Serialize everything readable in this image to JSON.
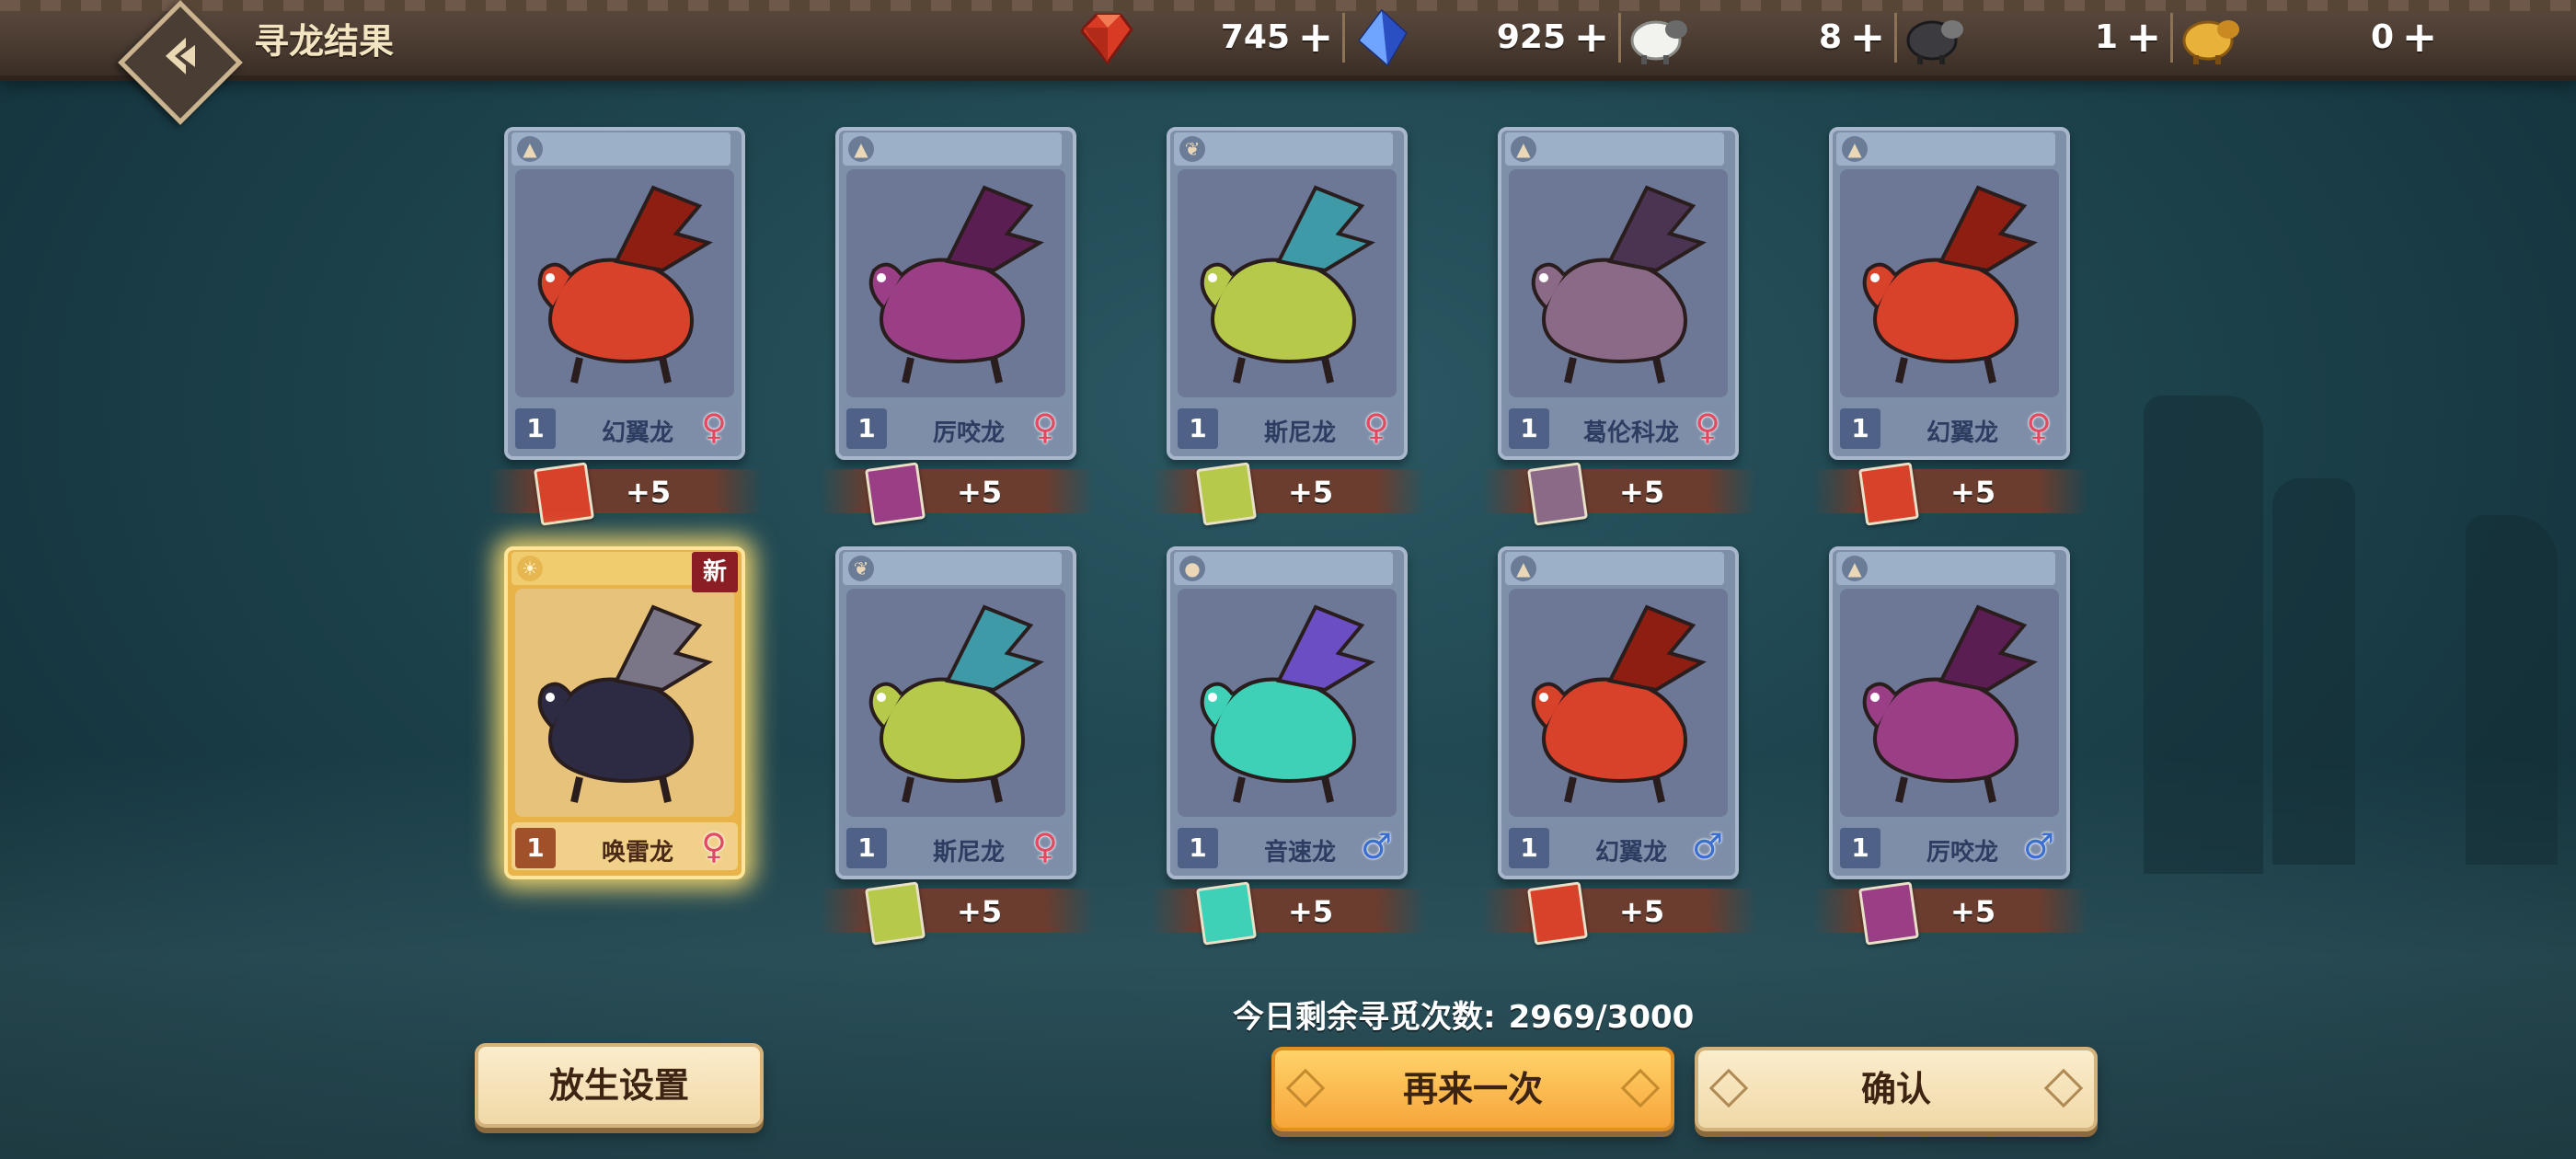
{
  "header": {
    "title": "寻龙结果",
    "resources": [
      {
        "icon": "red-gem-icon",
        "value": "745",
        "plus": "+"
      },
      {
        "icon": "blue-crystal-icon",
        "value": "925",
        "plus": "+"
      },
      {
        "icon": "white-sheep-icon",
        "value": "8",
        "plus": "+"
      },
      {
        "icon": "black-sheep-icon",
        "value": "1",
        "plus": "+"
      },
      {
        "icon": "golden-sheep-icon",
        "value": "0",
        "plus": "+"
      }
    ]
  },
  "cards": [
    {
      "level": "1",
      "name": "幻翼龙",
      "gender": "♀",
      "element": "earth",
      "reward": "+5",
      "new": false
    },
    {
      "level": "1",
      "name": "厉咬龙",
      "gender": "♀",
      "element": "earth",
      "reward": "+5",
      "new": false
    },
    {
      "level": "1",
      "name": "斯尼龙",
      "gender": "♀",
      "element": "leaf",
      "reward": "+5",
      "new": false
    },
    {
      "level": "1",
      "name": "葛伦科龙",
      "gender": "♀",
      "element": "earth",
      "reward": "+5",
      "new": false
    },
    {
      "level": "1",
      "name": "幻翼龙",
      "gender": "♀",
      "element": "earth",
      "reward": "+5",
      "new": false
    },
    {
      "level": "1",
      "name": "唤雷龙",
      "gender": "♀",
      "element": "sun",
      "reward": "",
      "new": true,
      "new_label": "新"
    },
    {
      "level": "1",
      "name": "斯尼龙",
      "gender": "♀",
      "element": "leaf",
      "reward": "+5",
      "new": false
    },
    {
      "level": "1",
      "name": "音速龙",
      "gender": "♂",
      "element": "water",
      "reward": "+5",
      "new": false
    },
    {
      "level": "1",
      "name": "幻翼龙",
      "gender": "♂",
      "element": "earth",
      "reward": "+5",
      "new": false
    },
    {
      "level": "1",
      "name": "厉咬龙",
      "gender": "♂",
      "element": "earth",
      "reward": "+5",
      "new": false
    }
  ],
  "footer": {
    "remaining_label": "今日剩余寻觅次数:",
    "remaining_value": "2969/3000",
    "release_button": "放生设置",
    "again_button": "再来一次",
    "confirm_button": "确认"
  },
  "colors": {
    "accent": "#f7a53a",
    "card": "#7e8fa8",
    "gold_card": "#e8b44a",
    "female": "#e04a62",
    "male": "#3a6fd0"
  }
}
